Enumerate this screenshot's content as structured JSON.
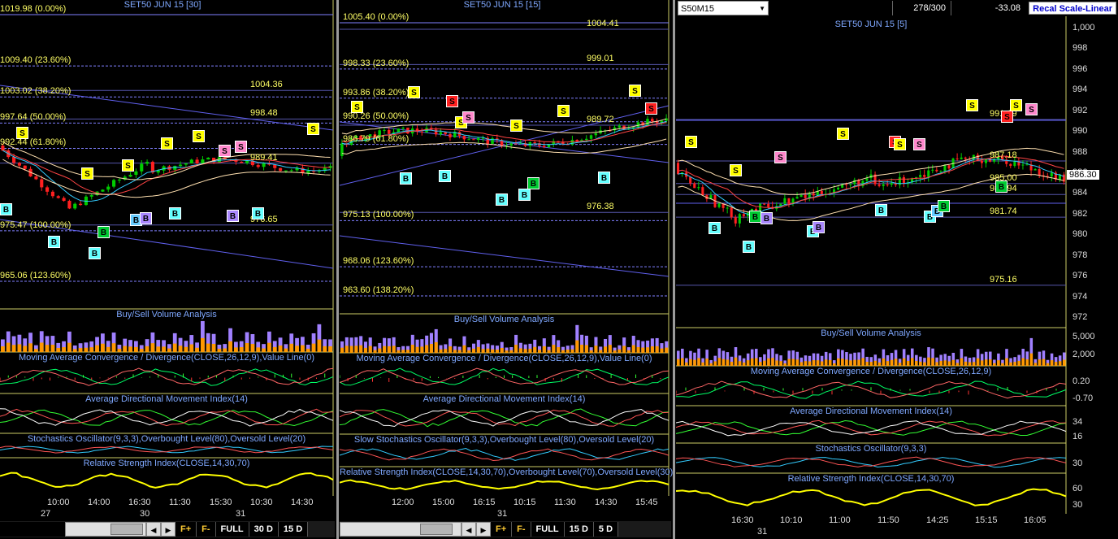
{
  "panel1": {
    "title": "SET50 JUN 15  [30]",
    "fib_levels": [
      {
        "label": "1019.98 (0.00%)",
        "value": 1019.98
      },
      {
        "label": "1009.40 (23.60%)",
        "value": 1009.4
      },
      {
        "label": "1003.02 (38.20%)",
        "value": 1003.02
      },
      {
        "label": "997.64 (50.00%)",
        "value": 997.64
      },
      {
        "label": "992.44 (61.80%)",
        "value": 992.44
      },
      {
        "label": "975.47 (100.00%)",
        "value": 975.47
      },
      {
        "label": "965.06 (123.60%)",
        "value": 965.06
      }
    ],
    "levels": [
      {
        "label": "1004.36",
        "value": 1004.36
      },
      {
        "label": "998.48",
        "value": 998.48
      },
      {
        "label": "989.41",
        "value": 989.41
      },
      {
        "label": "976.65",
        "value": 976.65
      }
    ],
    "indicators": [
      "Buy/Sell Volume Analysis",
      "Moving Average Convergence / Divergence(CLOSE,26,12,9),Value Line(0)",
      "Average Directional Movement Index(14)",
      "Stochastics Oscillator(9,3,3),Overbought Level(80),Oversold Level(20)",
      "Relative Strength Index(CLOSE,14,30,70)"
    ],
    "times": [
      "10:00",
      "14:00",
      "16:30",
      "11:30",
      "15:30",
      "10:30",
      "14:30"
    ],
    "dates": [
      "27",
      "30",
      "31"
    ],
    "buttons": [
      "FULL",
      "30 D",
      "15 D"
    ]
  },
  "panel2": {
    "title": "SET50 JUN 15  [15]",
    "fib_levels": [
      {
        "label": "1005.40 (0.00%)",
        "value": 1005.4
      },
      {
        "label": "998.33 (23.60%)",
        "value": 998.33
      },
      {
        "label": "993.86 (38.20%)",
        "value": 993.86
      },
      {
        "label": "990.26 (50.00%)",
        "value": 990.26
      },
      {
        "label": "986.79 (61.80%)",
        "value": 986.79
      },
      {
        "label": "975.13 (100.00%)",
        "value": 975.13
      },
      {
        "label": "968.06 (123.60%)",
        "value": 968.06
      },
      {
        "label": "963.60 (138.20%)",
        "value": 963.6
      }
    ],
    "levels": [
      {
        "label": "1004.41",
        "value": 1004.41
      },
      {
        "label": "999.01",
        "value": 999.01
      },
      {
        "label": "989.72",
        "value": 989.72
      },
      {
        "label": "976.38",
        "value": 976.38
      }
    ],
    "indicators": [
      "Buy/Sell Volume Analysis",
      "Moving Average Convergence / Divergence(CLOSE,26,12,9),Value Line(0)",
      "Average Directional Movement Index(14)",
      "Slow Stochastics Oscillator(9,3,3),Overbought Level(80),Oversold Level(20)",
      "Relative Strength Index(CLOSE,14,30,70),Overbought Level(70),Oversold Level(30)"
    ],
    "times": [
      "12:00",
      "15:00",
      "16:15",
      "10:15",
      "11:30",
      "14:30",
      "15:45"
    ],
    "dates": [
      "31"
    ],
    "buttons": [
      "FULL",
      "15 D",
      "5 D"
    ]
  },
  "panel3": {
    "symbol": "S50M15",
    "count": "278/300",
    "change": "-33.08",
    "recal_label": "Recal Scale-Linear",
    "title": "SET50 JUN 15  [5]",
    "price_axis": [
      "1,000",
      "998",
      "996",
      "994",
      "992",
      "990",
      "988",
      "986",
      "984",
      "982",
      "980",
      "978",
      "976",
      "974",
      "972"
    ],
    "current_price": "986.30",
    "levels": [
      {
        "label": "991.19",
        "value": 991.19
      },
      {
        "label": "987.18",
        "value": 987.18
      },
      {
        "label": "985.00",
        "value": 985.0
      },
      {
        "label": "983.94",
        "value": 983.94
      },
      {
        "label": "981.74",
        "value": 981.74
      },
      {
        "label": "975.16",
        "value": 975.16
      }
    ],
    "indicators": [
      "Buy/Sell Volume Analysis",
      "Moving Average Convergence / Divergence(CLOSE,26,12,9)",
      "Average Directional Movement Index(14)",
      "Stochastics Oscillator(9,3,3)",
      "Relative Strength Index(CLOSE,14,30,70)"
    ],
    "volume_axis": [
      "5,000",
      "2,000"
    ],
    "macd_axis": [
      "0.20",
      "-0.70"
    ],
    "adx_axis": [
      "34",
      "16"
    ],
    "stoch_axis": [
      "30"
    ],
    "rsi_axis": [
      "60",
      "30"
    ],
    "times": [
      "16:30",
      "10:10",
      "11:00",
      "11:50",
      "14:25",
      "15:15",
      "16:05"
    ],
    "dates": [
      "31"
    ]
  },
  "colors": {
    "fib": "#ffff66",
    "grid": "#6666cc",
    "up": "#00cc00",
    "down": "#ff2020",
    "buy": "#66ffff",
    "sell": "#ffff00"
  }
}
